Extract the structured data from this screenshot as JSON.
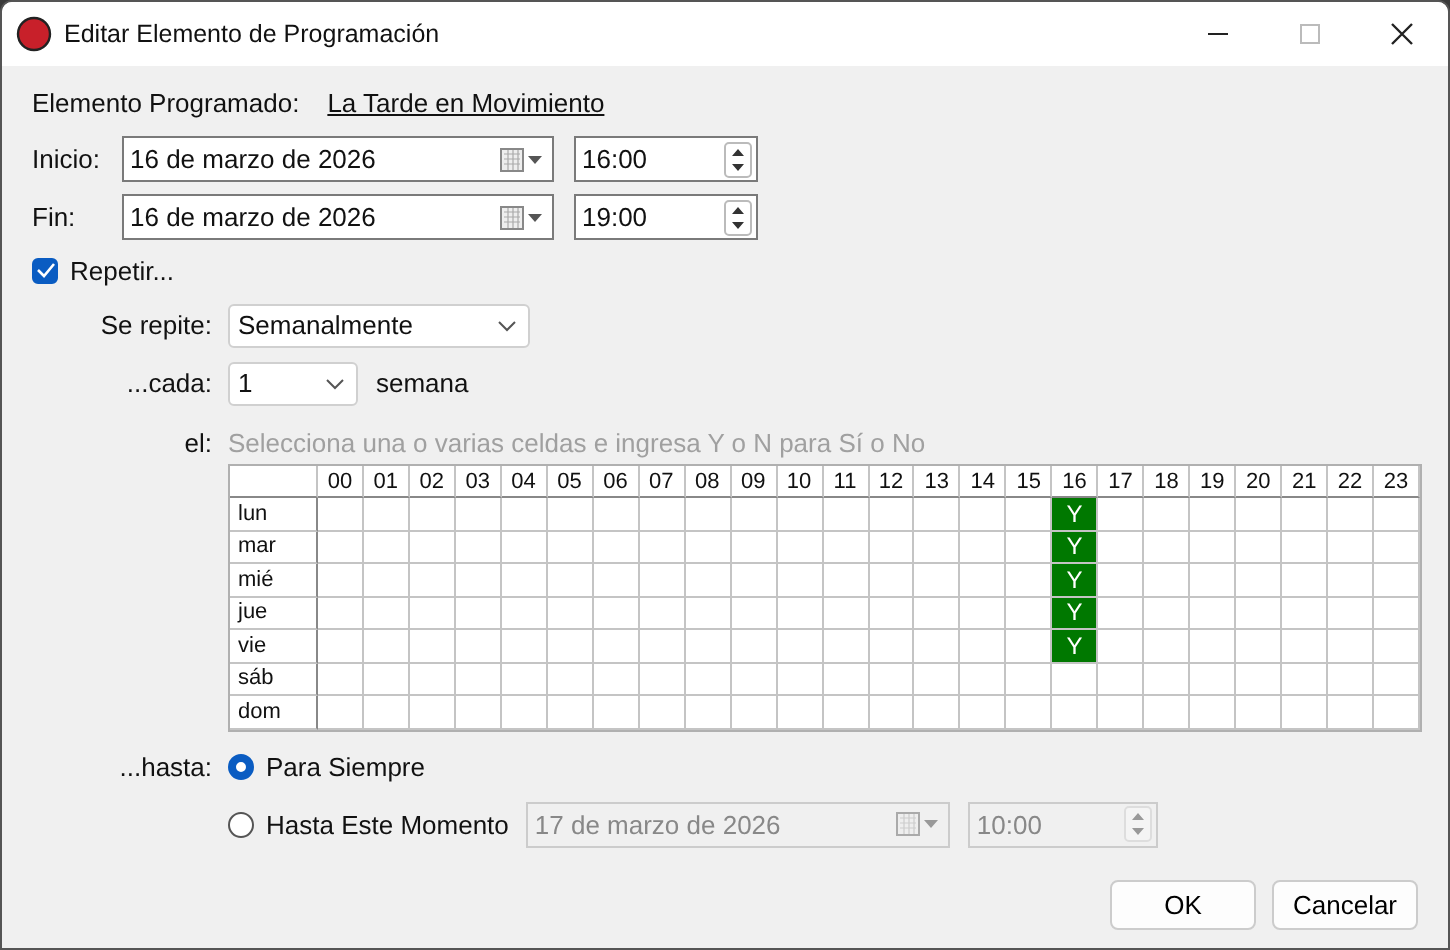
{
  "window": {
    "title": "Editar Elemento de Programación"
  },
  "scheduled_item": {
    "label": "Elemento Programado:",
    "value": "La Tarde en Movimiento"
  },
  "start": {
    "label": "Inicio:",
    "date": "16 de marzo de 2026",
    "time": "16:00"
  },
  "end": {
    "label": "Fin:",
    "date": "16 de marzo de 2026",
    "time": "19:00"
  },
  "repeat": {
    "label": "Repetir...",
    "checked": true
  },
  "repeats": {
    "label": "Se repite:",
    "value": "Semanalmente"
  },
  "every": {
    "label": "...cada:",
    "value": "1",
    "unit": "semana"
  },
  "on": {
    "label": "el:",
    "hint": "Selecciona una o varias celdas e ingresa Y o N para Sí o No"
  },
  "grid": {
    "hours": [
      "00",
      "01",
      "02",
      "03",
      "04",
      "05",
      "06",
      "07",
      "08",
      "09",
      "10",
      "11",
      "12",
      "13",
      "14",
      "15",
      "16",
      "17",
      "18",
      "19",
      "20",
      "21",
      "22",
      "23"
    ],
    "rows": [
      {
        "day": "lun",
        "cells": [
          {
            "filled": false
          },
          {
            "filled": false
          },
          {
            "filled": false
          },
          {
            "filled": false
          },
          {
            "filled": false
          },
          {
            "filled": false
          },
          {
            "filled": false
          },
          {
            "filled": false
          },
          {
            "filled": false
          },
          {
            "filled": false
          },
          {
            "filled": false
          },
          {
            "filled": false
          },
          {
            "filled": false
          },
          {
            "filled": false
          },
          {
            "filled": false
          },
          {
            "filled": false
          },
          {
            "filled": true,
            "text": "Y"
          },
          {
            "filled": false
          },
          {
            "filled": false
          },
          {
            "filled": false
          },
          {
            "filled": false
          },
          {
            "filled": false
          },
          {
            "filled": false
          },
          {
            "filled": false
          }
        ]
      },
      {
        "day": "mar",
        "cells": [
          {
            "filled": false
          },
          {
            "filled": false
          },
          {
            "filled": false
          },
          {
            "filled": false
          },
          {
            "filled": false
          },
          {
            "filled": false
          },
          {
            "filled": false
          },
          {
            "filled": false
          },
          {
            "filled": false
          },
          {
            "filled": false
          },
          {
            "filled": false
          },
          {
            "filled": false
          },
          {
            "filled": false
          },
          {
            "filled": false
          },
          {
            "filled": false
          },
          {
            "filled": false
          },
          {
            "filled": true,
            "text": "Y"
          },
          {
            "filled": false
          },
          {
            "filled": false
          },
          {
            "filled": false
          },
          {
            "filled": false
          },
          {
            "filled": false
          },
          {
            "filled": false
          },
          {
            "filled": false
          }
        ]
      },
      {
        "day": "mié",
        "cells": [
          {
            "filled": false
          },
          {
            "filled": false
          },
          {
            "filled": false
          },
          {
            "filled": false
          },
          {
            "filled": false
          },
          {
            "filled": false
          },
          {
            "filled": false
          },
          {
            "filled": false
          },
          {
            "filled": false
          },
          {
            "filled": false
          },
          {
            "filled": false
          },
          {
            "filled": false
          },
          {
            "filled": false
          },
          {
            "filled": false
          },
          {
            "filled": false
          },
          {
            "filled": false
          },
          {
            "filled": true,
            "text": "Y"
          },
          {
            "filled": false
          },
          {
            "filled": false
          },
          {
            "filled": false
          },
          {
            "filled": false
          },
          {
            "filled": false
          },
          {
            "filled": false
          },
          {
            "filled": false
          }
        ]
      },
      {
        "day": "jue",
        "cells": [
          {
            "filled": false
          },
          {
            "filled": false
          },
          {
            "filled": false
          },
          {
            "filled": false
          },
          {
            "filled": false
          },
          {
            "filled": false
          },
          {
            "filled": false
          },
          {
            "filled": false
          },
          {
            "filled": false
          },
          {
            "filled": false
          },
          {
            "filled": false
          },
          {
            "filled": false
          },
          {
            "filled": false
          },
          {
            "filled": false
          },
          {
            "filled": false
          },
          {
            "filled": false
          },
          {
            "filled": true,
            "text": "Y"
          },
          {
            "filled": false
          },
          {
            "filled": false
          },
          {
            "filled": false
          },
          {
            "filled": false
          },
          {
            "filled": false
          },
          {
            "filled": false
          },
          {
            "filled": false
          }
        ]
      },
      {
        "day": "vie",
        "cells": [
          {
            "filled": false
          },
          {
            "filled": false
          },
          {
            "filled": false
          },
          {
            "filled": false
          },
          {
            "filled": false
          },
          {
            "filled": false
          },
          {
            "filled": false
          },
          {
            "filled": false
          },
          {
            "filled": false
          },
          {
            "filled": false
          },
          {
            "filled": false
          },
          {
            "filled": false
          },
          {
            "filled": false
          },
          {
            "filled": false
          },
          {
            "filled": false
          },
          {
            "filled": false
          },
          {
            "filled": true,
            "text": "Y"
          },
          {
            "filled": false
          },
          {
            "filled": false
          },
          {
            "filled": false
          },
          {
            "filled": false
          },
          {
            "filled": false
          },
          {
            "filled": false
          },
          {
            "filled": false
          }
        ]
      },
      {
        "day": "sáb",
        "cells": [
          {
            "filled": false
          },
          {
            "filled": false
          },
          {
            "filled": false
          },
          {
            "filled": false
          },
          {
            "filled": false
          },
          {
            "filled": false
          },
          {
            "filled": false
          },
          {
            "filled": false
          },
          {
            "filled": false
          },
          {
            "filled": false
          },
          {
            "filled": false
          },
          {
            "filled": false
          },
          {
            "filled": false
          },
          {
            "filled": false
          },
          {
            "filled": false
          },
          {
            "filled": false
          },
          {
            "filled": false
          },
          {
            "filled": false
          },
          {
            "filled": false
          },
          {
            "filled": false
          },
          {
            "filled": false
          },
          {
            "filled": false
          },
          {
            "filled": false
          },
          {
            "filled": false
          }
        ]
      },
      {
        "day": "dom",
        "cells": [
          {
            "filled": false
          },
          {
            "filled": false
          },
          {
            "filled": false
          },
          {
            "filled": false
          },
          {
            "filled": false
          },
          {
            "filled": false
          },
          {
            "filled": false
          },
          {
            "filled": false
          },
          {
            "filled": false
          },
          {
            "filled": false
          },
          {
            "filled": false
          },
          {
            "filled": false
          },
          {
            "filled": false
          },
          {
            "filled": false
          },
          {
            "filled": false
          },
          {
            "filled": false
          },
          {
            "filled": false
          },
          {
            "filled": false
          },
          {
            "filled": false
          },
          {
            "filled": false
          },
          {
            "filled": false
          },
          {
            "filled": false
          },
          {
            "filled": false
          },
          {
            "filled": false
          }
        ]
      }
    ]
  },
  "until": {
    "label": "...hasta:",
    "options": [
      {
        "label": "Para Siempre",
        "selected": true
      },
      {
        "label": "Hasta Este Momento",
        "selected": false,
        "date": "17 de marzo de 2026",
        "time": "10:00",
        "disabled": true
      }
    ]
  },
  "buttons": [
    "OK",
    "Cancelar"
  ]
}
